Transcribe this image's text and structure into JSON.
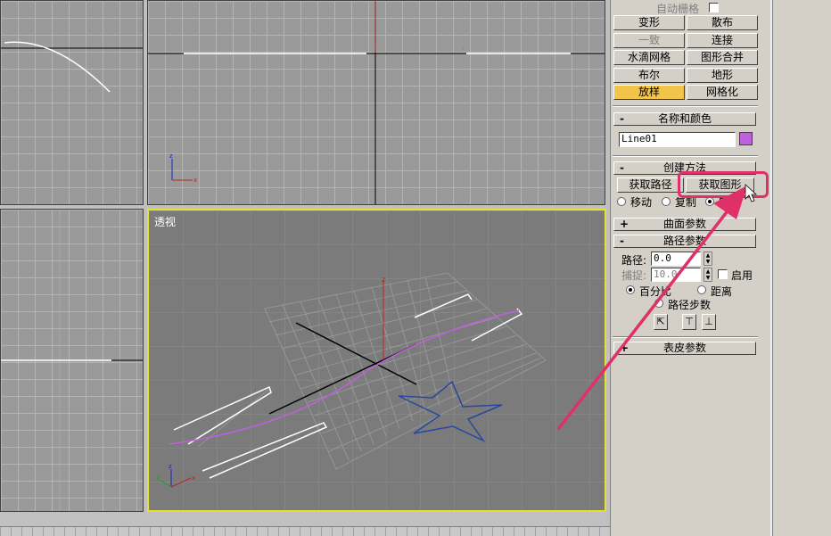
{
  "viewports": {
    "perspective_label": "透视"
  },
  "panel": {
    "auto_grid_label": "自动栅格",
    "compound_buttons": [
      {
        "label": "变形",
        "state": "normal"
      },
      {
        "label": "散布",
        "state": "normal"
      },
      {
        "label": "一致",
        "state": "disabled"
      },
      {
        "label": "连接",
        "state": "normal"
      },
      {
        "label": "水滴网格",
        "state": "normal"
      },
      {
        "label": "图形合并",
        "state": "normal"
      },
      {
        "label": "布尔",
        "state": "normal"
      },
      {
        "label": "地形",
        "state": "normal"
      },
      {
        "label": "放样",
        "state": "active"
      },
      {
        "label": "网格化",
        "state": "normal"
      }
    ],
    "name_color": {
      "header": "名称和颜色",
      "name_value": "Line01",
      "color": "#c060e0"
    },
    "creation_method": {
      "header": "创建方法",
      "get_path": "获取路径",
      "get_shape": "获取图形",
      "move": "移动",
      "copy": "复制",
      "instance": "实例"
    },
    "surface_params": {
      "header": "曲面参数"
    },
    "path_params": {
      "header": "路径参数",
      "path_label": "路径:",
      "path_value": "0.0",
      "snap_label": "捕捉:",
      "snap_value": "10.0",
      "enable_label": "启用",
      "percent_label": "百分比",
      "distance_label": "距离",
      "path_steps_label": "路径步数"
    },
    "skin_params": {
      "header": "表皮参数"
    }
  },
  "colors": {
    "highlight": "#e0306a",
    "active_button": "#f2c44a",
    "viewport_active_border": "#e8e030"
  }
}
